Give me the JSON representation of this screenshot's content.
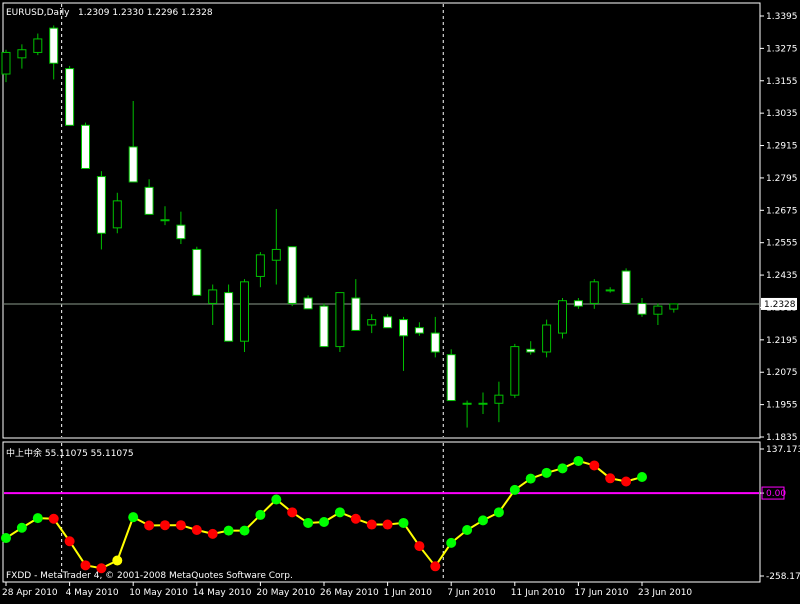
{
  "main_chart": {
    "title": "EURUSD,Daily",
    "ohlc_label": "1.2309 1.2330 1.2296 1.2328",
    "last_price_label": "1.2328",
    "last_price": 1.2328,
    "y_ticks": [
      "1.3395",
      "1.3275",
      "1.3155",
      "1.3035",
      "1.2915",
      "1.2795",
      "1.2675",
      "1.2555",
      "1.2435",
      "1.2315",
      "1.2195",
      "1.2075",
      "1.1955",
      "1.1835"
    ],
    "ylim": [
      1.1835,
      1.3395
    ],
    "vertical_marker_indices": [
      3,
      27
    ]
  },
  "indicator": {
    "label": "中上中余 55.11075 55.11075",
    "y_ticks": [
      "137.1737",
      "0.00",
      "-258.171"
    ],
    "ylim": [
      -258.171,
      137.1737
    ],
    "zero_level": 0,
    "watermark": "FXDD - MetaTrader 4, © 2001-2008 MetaQuotes Software Corp."
  },
  "x_labels": [
    {
      "text": "28 Apr 2010",
      "index": 0
    },
    {
      "text": "4 May 2010",
      "index": 4
    },
    {
      "text": "10 May 2010",
      "index": 8
    },
    {
      "text": "14 May 2010",
      "index": 12
    },
    {
      "text": "20 May 2010",
      "index": 16
    },
    {
      "text": "26 May 2010",
      "index": 20
    },
    {
      "text": "1 Jun 2010",
      "index": 24
    },
    {
      "text": "7 Jun 2010",
      "index": 28
    },
    {
      "text": "11 Jun 2010",
      "index": 32
    },
    {
      "text": "17 Jun 2010",
      "index": 36
    },
    {
      "text": "23 Jun 2010",
      "index": 40
    }
  ],
  "colors": {
    "background": "#000000",
    "bull_body": "#000000",
    "bear_body": "#ffffff",
    "wick": "#00c000",
    "grid_marker": "#ffffff",
    "price_line": "#8c9c8c",
    "text": "#ffffff",
    "zero_line": "#ff00ff",
    "indicator_line": "#ffff00",
    "dot_up": "#00ff00",
    "dot_down": "#ff0000"
  },
  "chart_data": [
    {
      "type": "candlestick",
      "title": "EURUSD,Daily",
      "ylim": [
        1.1835,
        1.3395
      ],
      "candles": [
        {
          "open": 1.318,
          "high": 1.327,
          "low": 1.315,
          "close": 1.326
        },
        {
          "open": 1.324,
          "high": 1.329,
          "low": 1.32,
          "close": 1.327
        },
        {
          "open": 1.326,
          "high": 1.333,
          "low": 1.325,
          "close": 1.331
        },
        {
          "open": 1.335,
          "high": 1.336,
          "low": 1.316,
          "close": 1.322
        },
        {
          "open": 1.32,
          "high": 1.321,
          "low": 1.299,
          "close": 1.299
        },
        {
          "open": 1.299,
          "high": 1.3,
          "low": 1.283,
          "close": 1.283
        },
        {
          "open": 1.28,
          "high": 1.282,
          "low": 1.253,
          "close": 1.259
        },
        {
          "open": 1.261,
          "high": 1.274,
          "low": 1.259,
          "close": 1.271
        },
        {
          "open": 1.291,
          "high": 1.308,
          "low": 1.281,
          "close": 1.278
        },
        {
          "open": 1.276,
          "high": 1.279,
          "low": 1.266,
          "close": 1.266
        },
        {
          "open": 1.264,
          "high": 1.269,
          "low": 1.262,
          "close": 1.264
        },
        {
          "open": 1.262,
          "high": 1.267,
          "low": 1.255,
          "close": 1.257
        },
        {
          "open": 1.253,
          "high": 1.254,
          "low": 1.236,
          "close": 1.236
        },
        {
          "open": 1.233,
          "high": 1.24,
          "low": 1.225,
          "close": 1.238
        },
        {
          "open": 1.237,
          "high": 1.24,
          "low": 1.219,
          "close": 1.219
        },
        {
          "open": 1.219,
          "high": 1.242,
          "low": 1.215,
          "close": 1.241
        },
        {
          "open": 1.243,
          "high": 1.252,
          "low": 1.239,
          "close": 1.251
        },
        {
          "open": 1.249,
          "high": 1.268,
          "low": 1.24,
          "close": 1.253
        },
        {
          "open": 1.254,
          "high": 1.254,
          "low": 1.232,
          "close": 1.233
        },
        {
          "open": 1.235,
          "high": 1.236,
          "low": 1.231,
          "close": 1.231
        },
        {
          "open": 1.232,
          "high": 1.233,
          "low": 1.217,
          "close": 1.217
        },
        {
          "open": 1.217,
          "high": 1.237,
          "low": 1.215,
          "close": 1.237
        },
        {
          "open": 1.235,
          "high": 1.242,
          "low": 1.223,
          "close": 1.223
        },
        {
          "open": 1.225,
          "high": 1.229,
          "low": 1.222,
          "close": 1.227
        },
        {
          "open": 1.228,
          "high": 1.229,
          "low": 1.224,
          "close": 1.224
        },
        {
          "open": 1.227,
          "high": 1.228,
          "low": 1.208,
          "close": 1.221
        },
        {
          "open": 1.224,
          "high": 1.226,
          "low": 1.221,
          "close": 1.222
        },
        {
          "open": 1.222,
          "high": 1.228,
          "low": 1.213,
          "close": 1.215
        },
        {
          "open": 1.214,
          "high": 1.216,
          "low": 1.197,
          "close": 1.197
        },
        {
          "open": 1.196,
          "high": 1.197,
          "low": 1.187,
          "close": 1.196
        },
        {
          "open": 1.196,
          "high": 1.2,
          "low": 1.192,
          "close": 1.196
        },
        {
          "open": 1.196,
          "high": 1.204,
          "low": 1.189,
          "close": 1.199
        },
        {
          "open": 1.199,
          "high": 1.218,
          "low": 1.198,
          "close": 1.217
        },
        {
          "open": 1.216,
          "high": 1.219,
          "low": 1.214,
          "close": 1.215
        },
        {
          "open": 1.215,
          "high": 1.227,
          "low": 1.213,
          "close": 1.225
        },
        {
          "open": 1.222,
          "high": 1.235,
          "low": 1.22,
          "close": 1.234
        },
        {
          "open": 1.234,
          "high": 1.235,
          "low": 1.231,
          "close": 1.232
        },
        {
          "open": 1.233,
          "high": 1.242,
          "low": 1.231,
          "close": 1.241
        },
        {
          "open": 1.238,
          "high": 1.239,
          "low": 1.237,
          "close": 1.238
        },
        {
          "open": 1.245,
          "high": 1.246,
          "low": 1.233,
          "close": 1.233
        },
        {
          "open": 1.233,
          "high": 1.235,
          "low": 1.228,
          "close": 1.229
        },
        {
          "open": 1.229,
          "high": 1.233,
          "low": 1.225,
          "close": 1.232
        },
        {
          "open": 1.2309,
          "high": 1.233,
          "low": 1.2296,
          "close": 1.2328
        }
      ]
    },
    {
      "type": "line",
      "ylim": [
        -258.171,
        137.1737
      ],
      "values": [
        -140,
        -108,
        -78,
        -80,
        -150,
        -225,
        -234,
        -210,
        -75,
        -101,
        -100,
        -100,
        -115,
        -127,
        -117,
        -117,
        -68,
        -20,
        -60,
        -93,
        -90,
        -60,
        -80,
        -98,
        -98,
        -93,
        -165,
        -228,
        -155,
        -115,
        -85,
        -60,
        10,
        45,
        63,
        77,
        100,
        86,
        46,
        36,
        50
      ],
      "dot_colors": [
        "green",
        "green",
        "green",
        "red",
        "red",
        "red",
        "red",
        "yellow",
        "green",
        "red",
        "red",
        "red",
        "red",
        "red",
        "green",
        "green",
        "green",
        "green",
        "red",
        "green",
        "green",
        "green",
        "red",
        "red",
        "red",
        "green",
        "red",
        "red",
        "green",
        "green",
        "green",
        "green",
        "green",
        "green",
        "green",
        "green",
        "green",
        "red",
        "red",
        "red",
        "green"
      ]
    }
  ]
}
